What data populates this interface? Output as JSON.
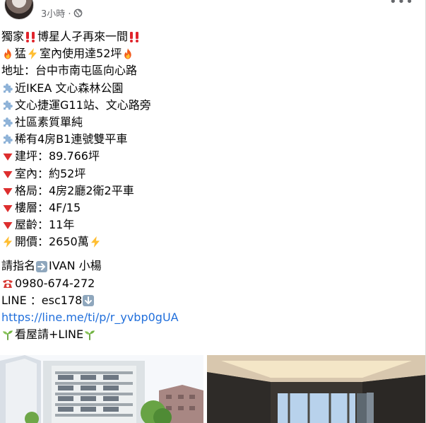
{
  "header": {
    "timestamp": "3小時 ·",
    "privacy_icon": "globe-icon",
    "menu_icon": "more-dots-icon"
  },
  "post": {
    "lines": [
      {
        "name": "exclusive-headline",
        "icon": "",
        "text": "獨家",
        "suffix_icon": "double-exclamation-icon",
        "text2": "博星人孑再來一間",
        "end_icon": "double-exclamation-icon"
      },
      {
        "name": "highlight-line",
        "icon": "fire-icon",
        "text": "猛",
        "suffix_icon": "lightning-icon",
        "text2": "室內使用達52坪",
        "end_icon": "fire-icon"
      },
      {
        "name": "address-line",
        "icon": "",
        "text": "地址：台中市南屯區向心路"
      },
      {
        "name": "feature-ikea",
        "icon": "puzzle-piece-icon",
        "text": "近IKEA 文心森林公園"
      },
      {
        "name": "feature-mrt",
        "icon": "puzzle-piece-icon",
        "text": "文心捷運G11站、文心路旁"
      },
      {
        "name": "feature-community",
        "icon": "puzzle-piece-icon",
        "text": "社區素質單純"
      },
      {
        "name": "feature-parking",
        "icon": "puzzle-piece-icon",
        "text": "稀有4房B1連號雙平車"
      },
      {
        "name": "spec-building-area",
        "icon": "red-triangle-icon",
        "text": "建坪：89.766坪"
      },
      {
        "name": "spec-indoor",
        "icon": "red-triangle-icon",
        "text": "室內：約52坪"
      },
      {
        "name": "spec-layout",
        "icon": "red-triangle-icon",
        "text": "格局：4房2廳2衛2平車"
      },
      {
        "name": "spec-floor",
        "icon": "red-triangle-icon",
        "text": "樓層：4F/15"
      },
      {
        "name": "spec-age",
        "icon": "red-triangle-icon",
        "text": "屋齡：11年"
      },
      {
        "name": "spec-price",
        "icon": "lightning-icon",
        "text": "開價：2650萬",
        "end_icon": "lightning-icon"
      }
    ],
    "contact": {
      "agent_prefix": "請指名",
      "agent_icon": "right-arrow-icon",
      "agent_name": " IVAN 小楊",
      "phone_icon": "telephone-icon",
      "phone": "0980-674-272",
      "line_label": "LINE ：esc178 ",
      "line_icon": "down-arrow-icon",
      "line_url": "https://line.me/ti/p/r_yvbp0gUA",
      "cta_icon": "seedling-icon",
      "cta_text": "看屋請+LINE ",
      "cta_end_icon": "seedling-icon"
    }
  },
  "photos": {
    "left_alt": "building-exterior-photo",
    "right_alt": "interior-room-photo"
  }
}
